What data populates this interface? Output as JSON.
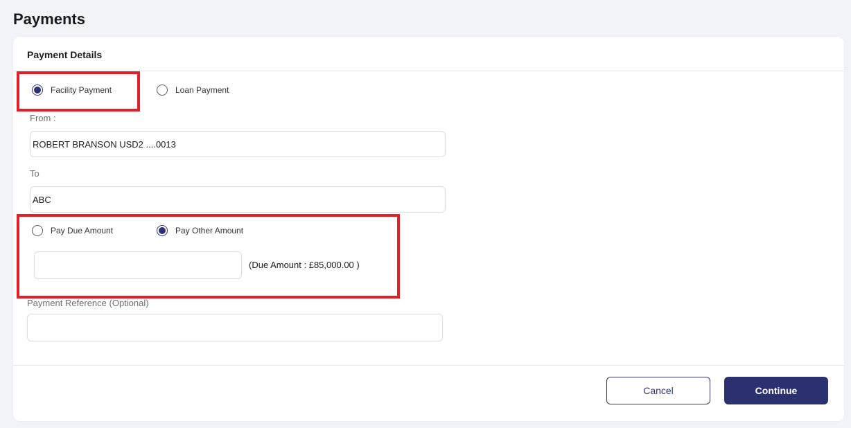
{
  "page": {
    "title": "Payments"
  },
  "card": {
    "section_title": "Payment Details"
  },
  "payment_type": {
    "options": [
      {
        "label": "Facility Payment",
        "checked": true
      },
      {
        "label": "Loan Payment",
        "checked": false
      }
    ]
  },
  "from": {
    "label": "From :",
    "value": "ROBERT BRANSON USD2 ....0013"
  },
  "to": {
    "label": "To",
    "value": "ABC"
  },
  "amount_type": {
    "options": [
      {
        "label": "Pay Due Amount",
        "checked": false
      },
      {
        "label": "Pay Other Amount",
        "checked": true
      }
    ],
    "amount_value": "",
    "due_note": "(Due Amount : £85,000.00 )"
  },
  "reference": {
    "label": "Payment Reference (Optional)",
    "value": ""
  },
  "actions": {
    "cancel_label": "Cancel",
    "continue_label": "Continue"
  },
  "colors": {
    "primary": "#2b3070",
    "highlight": "#e31e27",
    "background": "#f1f3f6"
  }
}
